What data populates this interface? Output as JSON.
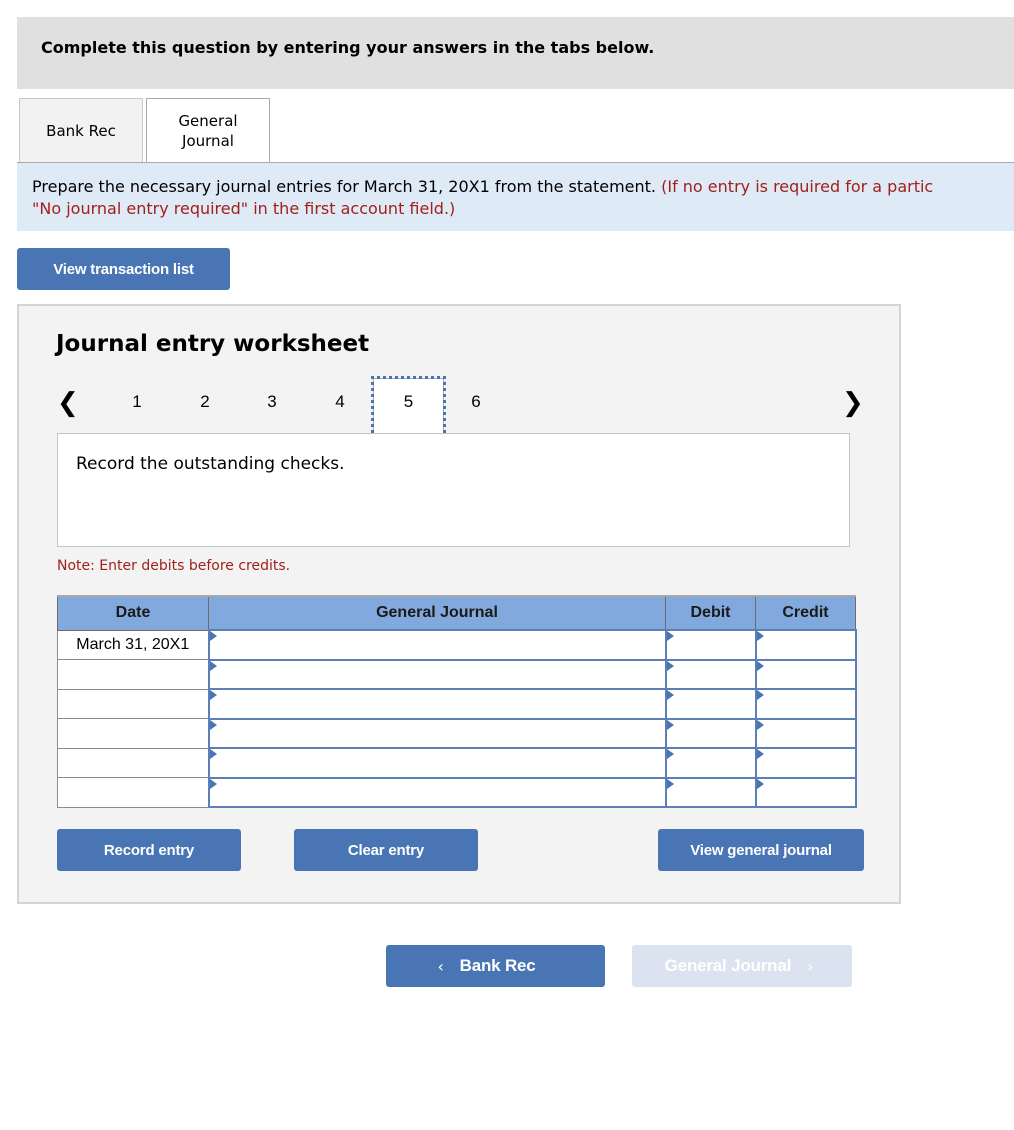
{
  "instruction": "Complete this question by entering your answers in the tabs below.",
  "tabs": [
    {
      "label": "Bank Rec",
      "active": false
    },
    {
      "label": "General\nJournal",
      "label_line1": "General",
      "label_line2": "Journal",
      "active": true
    }
  ],
  "prompt": {
    "text": "Prepare the necessary journal entries for March 31, 20X1 from the statement.",
    "red_text_line1": "(If no entry is required for a partic",
    "red_text_line2": "\"No journal entry required\" in the first account field.)"
  },
  "view_transaction_list_label": "View transaction list",
  "worksheet": {
    "title": "Journal entry worksheet",
    "pager": {
      "prev_icon": "chevron-left-icon",
      "next_icon": "chevron-right-icon",
      "pages": [
        "1",
        "2",
        "3",
        "4",
        "5",
        "6"
      ],
      "active_page": "5"
    },
    "description": "Record the outstanding checks.",
    "note": "Note: Enter debits before credits.",
    "table": {
      "headers": {
        "date": "Date",
        "account": "General Journal",
        "debit": "Debit",
        "credit": "Credit"
      },
      "rows": [
        {
          "date": "March 31, 20X1",
          "account": "",
          "debit": "",
          "credit": ""
        },
        {
          "date": "",
          "account": "",
          "debit": "",
          "credit": ""
        },
        {
          "date": "",
          "account": "",
          "debit": "",
          "credit": ""
        },
        {
          "date": "",
          "account": "",
          "debit": "",
          "credit": ""
        },
        {
          "date": "",
          "account": "",
          "debit": "",
          "credit": ""
        },
        {
          "date": "",
          "account": "",
          "debit": "",
          "credit": ""
        }
      ]
    },
    "buttons": {
      "record": "Record entry",
      "clear": "Clear entry",
      "view_general_journal": "View general journal"
    }
  },
  "bottom_nav": {
    "prev_label": "Bank Rec",
    "prev_icon": "chevron-left-icon",
    "next_label": "General Journal",
    "next_icon": "chevron-right-icon",
    "next_disabled": true
  },
  "colors": {
    "accent": "#4a75b5",
    "table_header": "#82a9dd",
    "prompt_bg": "#dfeaf7",
    "red_text": "#a1201a",
    "disabled_button": "#dae3ef"
  }
}
